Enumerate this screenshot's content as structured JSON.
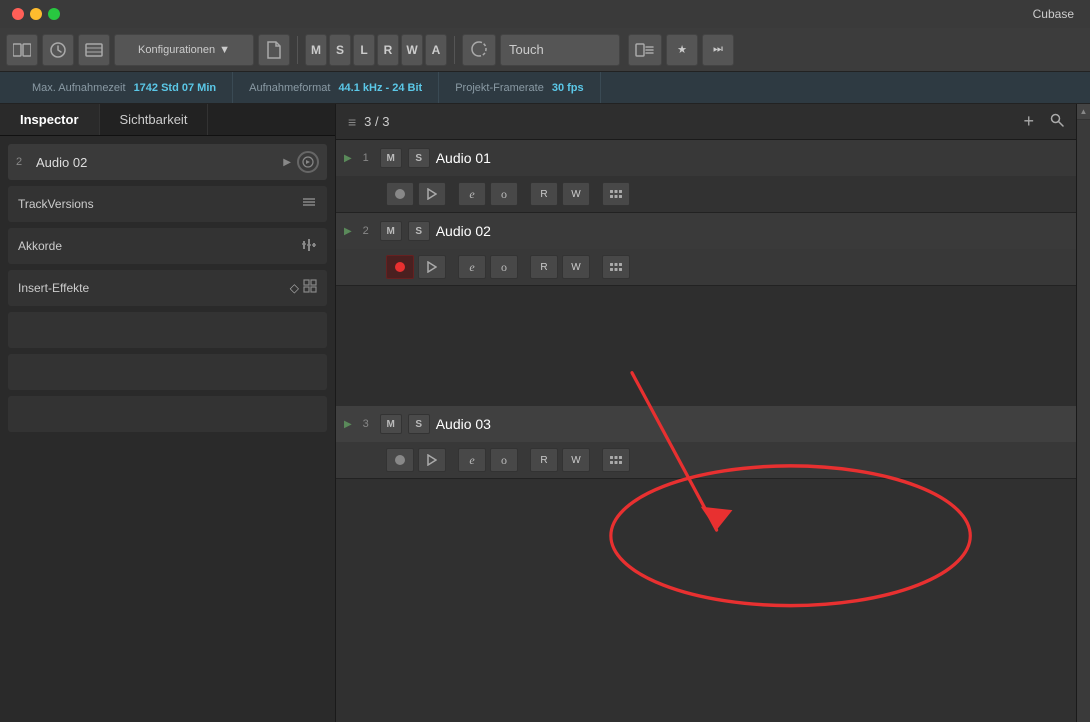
{
  "titleBar": {
    "title": "Cubase"
  },
  "toolbar": {
    "konfigBtn": "Konfigurationen",
    "transportLetters": [
      "M",
      "S",
      "L",
      "R",
      "W",
      "A"
    ],
    "touchLabel": "Touch"
  },
  "infoBar": {
    "items": [
      {
        "label": "Max. Aufnahmezeit",
        "value": "1742 Std 07 Min"
      },
      {
        "label": "Aufnahmeformat",
        "value": "44.1 kHz - 24 Bit"
      },
      {
        "label": "Projekt-Framerate",
        "value": "30 fps"
      }
    ]
  },
  "leftPanel": {
    "tabs": [
      {
        "label": "Inspector",
        "active": true
      },
      {
        "label": "Sichtbarkeit",
        "active": false
      }
    ],
    "inspector": {
      "trackNum": "2",
      "trackName": "Audio 02",
      "sections": [
        {
          "name": "TrackVersions",
          "icon": "lines"
        },
        {
          "name": "Akkorde",
          "icon": "sliders"
        },
        {
          "name": "Insert-Effekte",
          "icon": "diamond"
        }
      ]
    }
  },
  "tracksPanel": {
    "headerIcon": "≡",
    "count": "3 / 3",
    "addBtn": "+",
    "searchBtn": "🔍",
    "tracks": [
      {
        "num": "1",
        "name": "Audio 01",
        "recordActive": false
      },
      {
        "num": "2",
        "name": "Audio 02",
        "recordActive": true
      },
      {
        "num": "3",
        "name": "Audio 03",
        "recordActive": false
      }
    ]
  },
  "annotation": {
    "arrowLabel": "Arrow pointing to Audio 03",
    "circleLabel": "Highlighted circle around Audio 03"
  }
}
